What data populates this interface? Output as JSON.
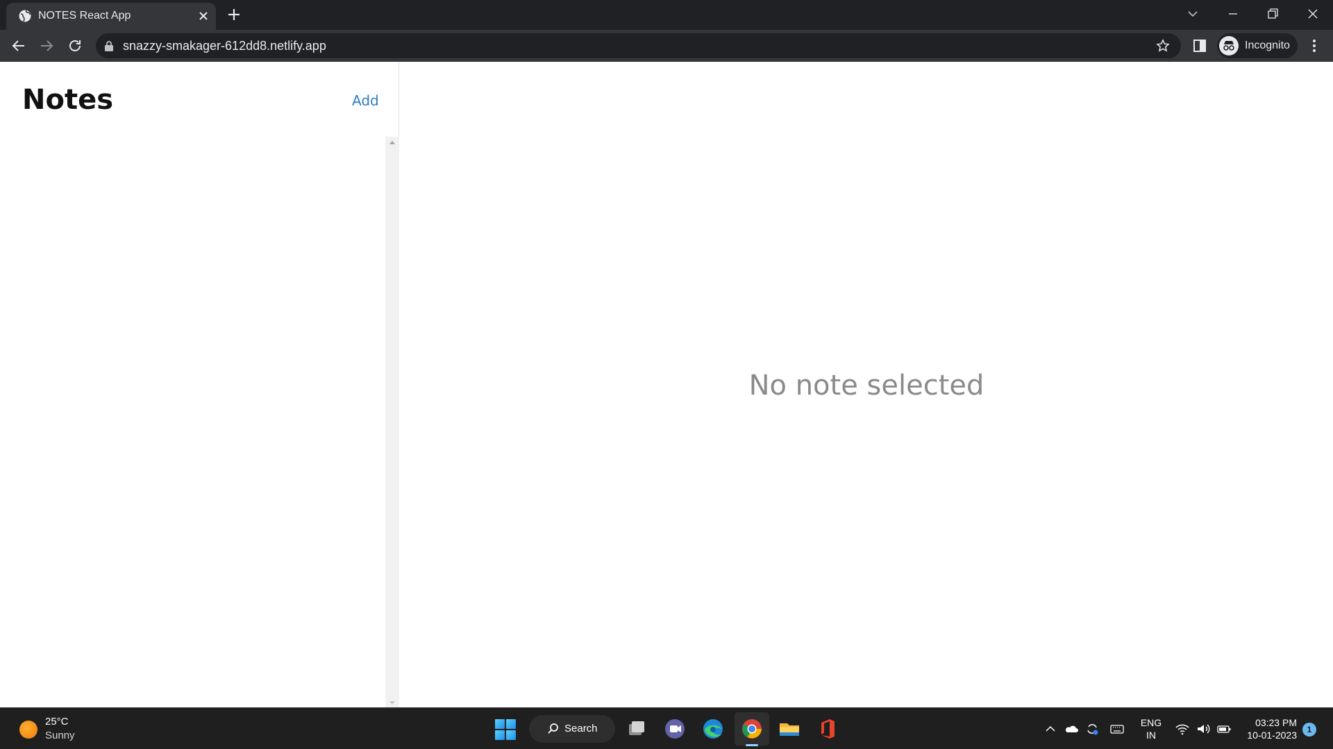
{
  "browser": {
    "tab_title": "NOTES React App",
    "url": "snazzy-smakager-612dd8.netlify.app",
    "profile_label": "Incognito"
  },
  "app": {
    "sidebar_title": "Notes",
    "add_label": "Add",
    "empty_state": "No note selected",
    "accent_color": "#2f7ec2"
  },
  "taskbar": {
    "weather": {
      "temp": "25°C",
      "condition": "Sunny"
    },
    "search_label": "Search",
    "apps": [
      "file-explorer-icon",
      "teams-chat-icon",
      "edge-icon",
      "chrome-icon",
      "folder-icon",
      "office-icon"
    ],
    "language": {
      "line1": "ENG",
      "line2": "IN"
    },
    "clock": {
      "time": "03:23 PM",
      "date": "10-01-2023"
    },
    "notification_count": "1"
  }
}
